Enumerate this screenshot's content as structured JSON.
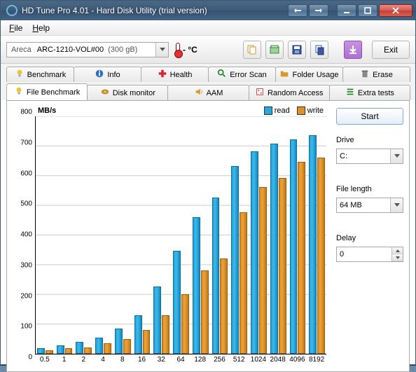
{
  "window": {
    "title": "HD Tune Pro 4.01 - Hard Disk Utility (trial version)"
  },
  "menu": {
    "file": "File",
    "help": "Help"
  },
  "toolbar": {
    "drive_vendor": "Areca",
    "drive_model": "ARC-1210-VOL#00",
    "drive_size": "(300 gB)",
    "temp_label": "- °C",
    "exit": "Exit"
  },
  "tabs_row1": [
    {
      "label": "Benchmark",
      "icon": "bulb"
    },
    {
      "label": "Info",
      "icon": "info"
    },
    {
      "label": "Health",
      "icon": "cross"
    },
    {
      "label": "Error Scan",
      "icon": "search"
    },
    {
      "label": "Folder Usage",
      "icon": "folder"
    },
    {
      "label": "Erase",
      "icon": "trash"
    }
  ],
  "tabs_row2": [
    {
      "label": "File Benchmark",
      "icon": "bulb",
      "active": true
    },
    {
      "label": "Disk monitor",
      "icon": "disk"
    },
    {
      "label": "AAM",
      "icon": "speaker"
    },
    {
      "label": "Random Access",
      "icon": "dice"
    },
    {
      "label": "Extra tests",
      "icon": "list"
    }
  ],
  "controls": {
    "start": "Start",
    "drive_label": "Drive",
    "drive_value": "C:",
    "filelen_label": "File length",
    "filelen_value": "64 MB",
    "delay_label": "Delay",
    "delay_value": "0"
  },
  "chart_data": {
    "type": "bar",
    "ylabel": "MB/s",
    "ylim": [
      0,
      800
    ],
    "yticks": [
      0,
      100,
      200,
      300,
      400,
      500,
      600,
      700,
      800
    ],
    "categories": [
      "0.5",
      "1",
      "2",
      "4",
      "8",
      "16",
      "32",
      "64",
      "128",
      "256",
      "512",
      "1024",
      "2048",
      "4096",
      "8192"
    ],
    "series": [
      {
        "name": "read",
        "color": "#28a9de",
        "values": [
          18,
          28,
          40,
          55,
          85,
          130,
          225,
          345,
          460,
          525,
          630,
          680,
          705,
          720,
          735
        ]
      },
      {
        "name": "write",
        "color": "#df9126",
        "values": [
          12,
          18,
          22,
          35,
          50,
          80,
          130,
          200,
          280,
          320,
          475,
          560,
          590,
          645,
          660
        ]
      }
    ],
    "legend": [
      {
        "label": "read",
        "color": "#28a9de"
      },
      {
        "label": "write",
        "color": "#df9126"
      }
    ]
  }
}
